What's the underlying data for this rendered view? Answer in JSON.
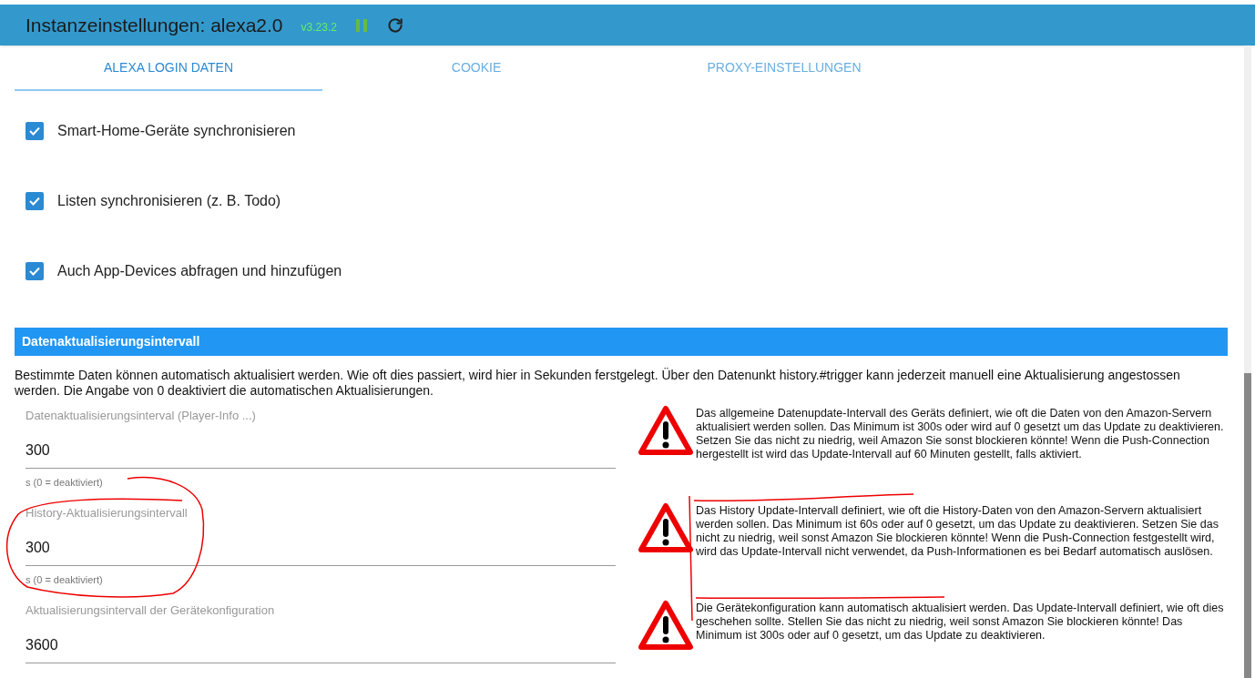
{
  "header": {
    "title": "Instanzeinstellungen: alexa2.0",
    "version": "v3.23.2",
    "running": true
  },
  "tabs": [
    {
      "label": "ALEXA LOGIN DATEN",
      "selected": true
    },
    {
      "label": "COOKIE",
      "selected": false
    },
    {
      "label": "PROXY-EINSTELLUNGEN",
      "selected": false
    }
  ],
  "checkboxes": [
    {
      "label": "Smart-Home-Geräte synchronisieren",
      "checked": true
    },
    {
      "label": "Listen synchronisieren (z. B. Todo)",
      "checked": true
    },
    {
      "label": "Auch App-Devices abfragen und hinzufügen",
      "checked": true
    }
  ],
  "section": {
    "title": "Datenaktualisierungsintervall",
    "description": "Bestimmte Daten können automatisch aktualisiert werden. Wie oft dies passiert, wird hier in Sekunden ferstgelegt. Über den Datenunkt history.#trigger kann jederzeit manuell eine Aktualisierung angestossen werden. Die Angabe von 0 deaktiviert die automatischen Aktualisierungen."
  },
  "fields": [
    {
      "label": "Datenaktualisierungsinterval (Player-Info ...)",
      "value": "300",
      "helper": "s (0 = deaktiviert)",
      "warning": "Das allgemeine Datenupdate-Intervall des Geräts definiert, wie oft die Daten von den Amazon-Servern aktualisiert werden sollen. Das Minimum ist 300s oder wird auf 0 gesetzt um das Update zu deaktivieren. Setzen Sie das nicht zu niedrig, weil Amazon Sie sonst blockieren könnte! Wenn die Push-Connection hergestellt ist wird das Update-Intervall auf 60 Minuten gestellt, falls aktiviert."
    },
    {
      "label": "History-Aktualisierungsintervall",
      "value": "300",
      "helper": "s (0 = deaktiviert)",
      "warning": "Das History Update-Intervall definiert, wie oft die History-Daten von den Amazon-Servern aktualisiert werden sollen. Das Minimum ist 60s oder auf 0 gesetzt, um das Update zu deaktivieren. Setzen Sie das nicht zu niedrig, weil sonst Amazon Sie blockieren könnte! Wenn die Push-Connection festgestellt wird, wird das Update-Intervall nicht verwendet, da Push-Informationen es bei Bedarf automatisch auslösen."
    },
    {
      "label": "Aktualisierungsintervall der Gerätekonfiguration",
      "value": "3600",
      "warning": "Die Gerätekonfiguration kann automatisch aktualisiert werden. Das Update-Intervall definiert, wie oft dies geschehen sollte. Stellen Sie das nicht zu niedrig, weil sonst Amazon Sie blockieren könnte! Das Minimum ist 300s oder auf 0 gesetzt, um das Update zu deaktivieren."
    }
  ]
}
